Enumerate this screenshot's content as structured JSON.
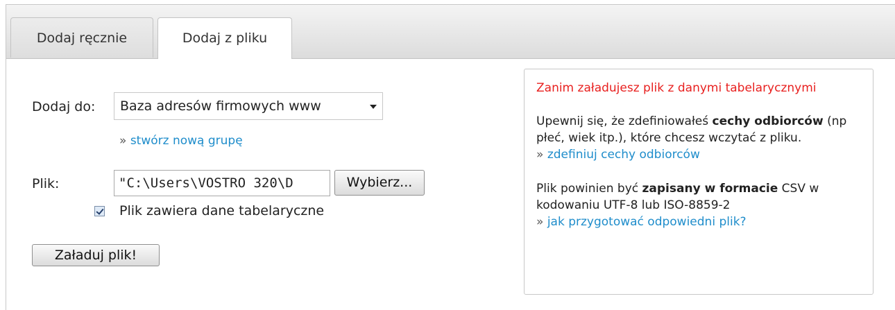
{
  "tabs": [
    {
      "label": "Dodaj ręcznie",
      "active": false
    },
    {
      "label": "Dodaj z pliku",
      "active": true
    }
  ],
  "form": {
    "add_to_label": "Dodaj do:",
    "add_to_value": "Baza adresów firmowych www",
    "raquo": "»",
    "new_group_link": "stwórz nową grupę",
    "file_label": "Plik:",
    "file_value": "\"C:\\Users\\VOSTRO 320\\D",
    "browse_button": "Wybierz...",
    "checkbox_checked": true,
    "checkbox_label": "Plik zawiera dane tabelaryczne",
    "submit_button": "Załaduj plik!"
  },
  "info": {
    "warning_title": "Zanim załadujesz plik z danymi tabelarycznymi",
    "p1_prefix": "Upewnij się, że zdefiniowałeś ",
    "p1_bold": "cechy odbiorców",
    "p1_suffix": " (np płeć, wiek itp.), które chcesz wczytać z pliku.",
    "p1_link": "zdefiniuj cechy odbiorców",
    "p2_prefix": "Plik powinien być ",
    "p2_bold": "zapisany w formacie",
    "p2_suffix": " CSV w kodowaniu UTF-8 lub ISO-8859-2",
    "p2_link": "jak przygotować odpowiedni plik?",
    "raquo": "»"
  },
  "colors": {
    "link": "#1f8dcb",
    "warning": "#e8201f"
  }
}
